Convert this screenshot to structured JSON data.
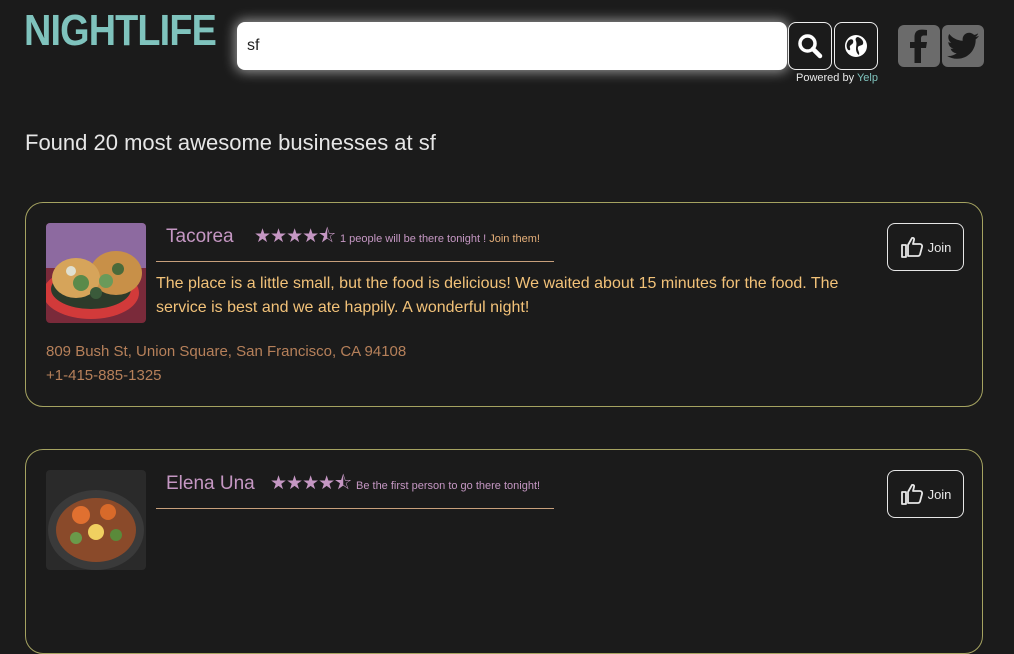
{
  "header": {
    "logo": "NIGHTLIFE",
    "search_value": "sf",
    "powered_prefix": "Powered by ",
    "powered_brand": "Yelp",
    "search_icon": "search-icon",
    "globe_icon": "globe-icon",
    "facebook_icon": "facebook-icon",
    "twitter_icon": "twitter-icon"
  },
  "results": {
    "heading": "Found 20 most awesome businesses at sf"
  },
  "businesses": [
    {
      "name": "Tacorea",
      "rating": 4.5,
      "stars_text": "★★★★⯪",
      "attendance": "1 people will be there tonight ! ",
      "attendance_cta": "Join them!",
      "review": "The place is a little small, but the food is delicious! We waited about 15 minutes for the food. The service is best and we ate happily. A wonderful night!",
      "address": "809 Bush St, Union Square, San Francisco, CA 94108",
      "phone": "+1-415-885-1325",
      "join_label": "Join"
    },
    {
      "name": "Elena Una",
      "rating": 4.5,
      "stars_text": "★★★★⯪",
      "attendance": "Be the first person to go there tonight!",
      "join_label": "Join"
    }
  ],
  "colors": {
    "background": "#1b1b1b",
    "accent_teal": "#7fc3bd",
    "name_purple": "#c597c3",
    "review_orange": "#f2c279",
    "address_brown": "#b6805a",
    "card_border": "#a5a361"
  }
}
